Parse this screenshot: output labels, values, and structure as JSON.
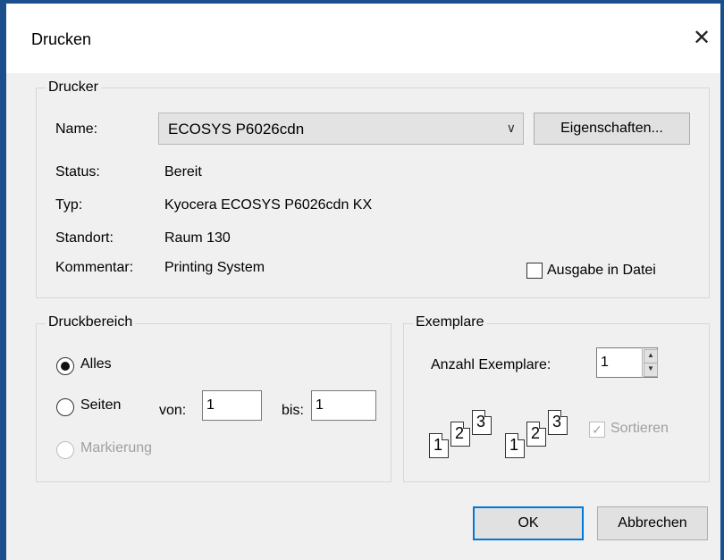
{
  "window": {
    "title": "Drucken",
    "close_glyph": "✕"
  },
  "drucker": {
    "legend": "Drucker",
    "name_label": "Name:",
    "name_value": "ECOSYS P6026cdn",
    "properties_button": "Eigenschaften...",
    "status_label": "Status:",
    "status_value": "Bereit",
    "typ_label": "Typ:",
    "typ_value": "Kyocera ECOSYS P6026cdn KX",
    "standort_label": "Standort:",
    "standort_value": "Raum 130",
    "kommentar_label": "Kommentar:",
    "kommentar_value": "Printing System",
    "ausgabe_label": "Ausgabe in Datei",
    "ausgabe_checked": false
  },
  "druckbereich": {
    "legend": "Druckbereich",
    "alles_label": "Alles",
    "seiten_label": "Seiten",
    "von_label": "von:",
    "von_value": "1",
    "bis_label": "bis:",
    "bis_value": "1",
    "markierung_label": "Markierung",
    "selected": "Alles"
  },
  "exemplare": {
    "legend": "Exemplare",
    "anzahl_label": "Anzahl Exemplare:",
    "anzahl_value": "1",
    "sortieren_label": "Sortieren",
    "sortieren_checked": true,
    "sortieren_enabled": false,
    "collate_pages": [
      "1",
      "2",
      "3",
      "1",
      "2",
      "3"
    ]
  },
  "footer": {
    "ok_label": "OK",
    "cancel_label": "Abbrechen"
  }
}
